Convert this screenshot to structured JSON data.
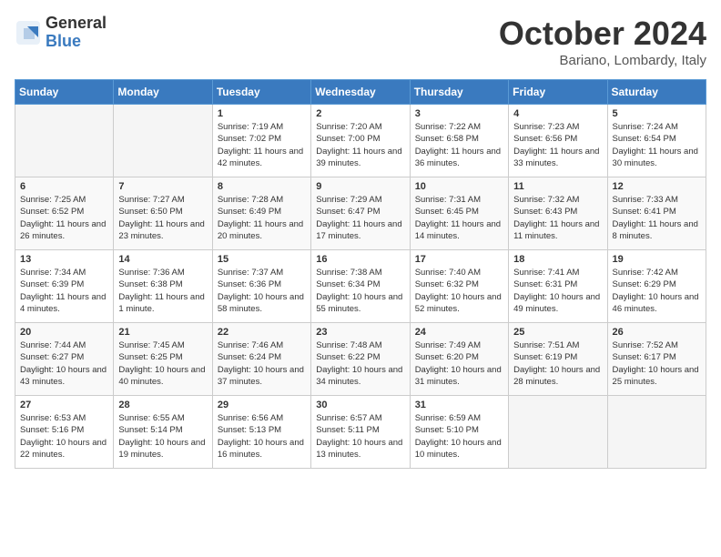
{
  "logo": {
    "general": "General",
    "blue": "Blue"
  },
  "title": "October 2024",
  "location": "Bariano, Lombardy, Italy",
  "days_of_week": [
    "Sunday",
    "Monday",
    "Tuesday",
    "Wednesday",
    "Thursday",
    "Friday",
    "Saturday"
  ],
  "weeks": [
    [
      {
        "day": "",
        "sunrise": "",
        "sunset": "",
        "daylight": ""
      },
      {
        "day": "",
        "sunrise": "",
        "sunset": "",
        "daylight": ""
      },
      {
        "day": "1",
        "sunrise": "Sunrise: 7:19 AM",
        "sunset": "Sunset: 7:02 PM",
        "daylight": "Daylight: 11 hours and 42 minutes."
      },
      {
        "day": "2",
        "sunrise": "Sunrise: 7:20 AM",
        "sunset": "Sunset: 7:00 PM",
        "daylight": "Daylight: 11 hours and 39 minutes."
      },
      {
        "day": "3",
        "sunrise": "Sunrise: 7:22 AM",
        "sunset": "Sunset: 6:58 PM",
        "daylight": "Daylight: 11 hours and 36 minutes."
      },
      {
        "day": "4",
        "sunrise": "Sunrise: 7:23 AM",
        "sunset": "Sunset: 6:56 PM",
        "daylight": "Daylight: 11 hours and 33 minutes."
      },
      {
        "day": "5",
        "sunrise": "Sunrise: 7:24 AM",
        "sunset": "Sunset: 6:54 PM",
        "daylight": "Daylight: 11 hours and 30 minutes."
      }
    ],
    [
      {
        "day": "6",
        "sunrise": "Sunrise: 7:25 AM",
        "sunset": "Sunset: 6:52 PM",
        "daylight": "Daylight: 11 hours and 26 minutes."
      },
      {
        "day": "7",
        "sunrise": "Sunrise: 7:27 AM",
        "sunset": "Sunset: 6:50 PM",
        "daylight": "Daylight: 11 hours and 23 minutes."
      },
      {
        "day": "8",
        "sunrise": "Sunrise: 7:28 AM",
        "sunset": "Sunset: 6:49 PM",
        "daylight": "Daylight: 11 hours and 20 minutes."
      },
      {
        "day": "9",
        "sunrise": "Sunrise: 7:29 AM",
        "sunset": "Sunset: 6:47 PM",
        "daylight": "Daylight: 11 hours and 17 minutes."
      },
      {
        "day": "10",
        "sunrise": "Sunrise: 7:31 AM",
        "sunset": "Sunset: 6:45 PM",
        "daylight": "Daylight: 11 hours and 14 minutes."
      },
      {
        "day": "11",
        "sunrise": "Sunrise: 7:32 AM",
        "sunset": "Sunset: 6:43 PM",
        "daylight": "Daylight: 11 hours and 11 minutes."
      },
      {
        "day": "12",
        "sunrise": "Sunrise: 7:33 AM",
        "sunset": "Sunset: 6:41 PM",
        "daylight": "Daylight: 11 hours and 8 minutes."
      }
    ],
    [
      {
        "day": "13",
        "sunrise": "Sunrise: 7:34 AM",
        "sunset": "Sunset: 6:39 PM",
        "daylight": "Daylight: 11 hours and 4 minutes."
      },
      {
        "day": "14",
        "sunrise": "Sunrise: 7:36 AM",
        "sunset": "Sunset: 6:38 PM",
        "daylight": "Daylight: 11 hours and 1 minute."
      },
      {
        "day": "15",
        "sunrise": "Sunrise: 7:37 AM",
        "sunset": "Sunset: 6:36 PM",
        "daylight": "Daylight: 10 hours and 58 minutes."
      },
      {
        "day": "16",
        "sunrise": "Sunrise: 7:38 AM",
        "sunset": "Sunset: 6:34 PM",
        "daylight": "Daylight: 10 hours and 55 minutes."
      },
      {
        "day": "17",
        "sunrise": "Sunrise: 7:40 AM",
        "sunset": "Sunset: 6:32 PM",
        "daylight": "Daylight: 10 hours and 52 minutes."
      },
      {
        "day": "18",
        "sunrise": "Sunrise: 7:41 AM",
        "sunset": "Sunset: 6:31 PM",
        "daylight": "Daylight: 10 hours and 49 minutes."
      },
      {
        "day": "19",
        "sunrise": "Sunrise: 7:42 AM",
        "sunset": "Sunset: 6:29 PM",
        "daylight": "Daylight: 10 hours and 46 minutes."
      }
    ],
    [
      {
        "day": "20",
        "sunrise": "Sunrise: 7:44 AM",
        "sunset": "Sunset: 6:27 PM",
        "daylight": "Daylight: 10 hours and 43 minutes."
      },
      {
        "day": "21",
        "sunrise": "Sunrise: 7:45 AM",
        "sunset": "Sunset: 6:25 PM",
        "daylight": "Daylight: 10 hours and 40 minutes."
      },
      {
        "day": "22",
        "sunrise": "Sunrise: 7:46 AM",
        "sunset": "Sunset: 6:24 PM",
        "daylight": "Daylight: 10 hours and 37 minutes."
      },
      {
        "day": "23",
        "sunrise": "Sunrise: 7:48 AM",
        "sunset": "Sunset: 6:22 PM",
        "daylight": "Daylight: 10 hours and 34 minutes."
      },
      {
        "day": "24",
        "sunrise": "Sunrise: 7:49 AM",
        "sunset": "Sunset: 6:20 PM",
        "daylight": "Daylight: 10 hours and 31 minutes."
      },
      {
        "day": "25",
        "sunrise": "Sunrise: 7:51 AM",
        "sunset": "Sunset: 6:19 PM",
        "daylight": "Daylight: 10 hours and 28 minutes."
      },
      {
        "day": "26",
        "sunrise": "Sunrise: 7:52 AM",
        "sunset": "Sunset: 6:17 PM",
        "daylight": "Daylight: 10 hours and 25 minutes."
      }
    ],
    [
      {
        "day": "27",
        "sunrise": "Sunrise: 6:53 AM",
        "sunset": "Sunset: 5:16 PM",
        "daylight": "Daylight: 10 hours and 22 minutes."
      },
      {
        "day": "28",
        "sunrise": "Sunrise: 6:55 AM",
        "sunset": "Sunset: 5:14 PM",
        "daylight": "Daylight: 10 hours and 19 minutes."
      },
      {
        "day": "29",
        "sunrise": "Sunrise: 6:56 AM",
        "sunset": "Sunset: 5:13 PM",
        "daylight": "Daylight: 10 hours and 16 minutes."
      },
      {
        "day": "30",
        "sunrise": "Sunrise: 6:57 AM",
        "sunset": "Sunset: 5:11 PM",
        "daylight": "Daylight: 10 hours and 13 minutes."
      },
      {
        "day": "31",
        "sunrise": "Sunrise: 6:59 AM",
        "sunset": "Sunset: 5:10 PM",
        "daylight": "Daylight: 10 hours and 10 minutes."
      },
      {
        "day": "",
        "sunrise": "",
        "sunset": "",
        "daylight": ""
      },
      {
        "day": "",
        "sunrise": "",
        "sunset": "",
        "daylight": ""
      }
    ]
  ]
}
